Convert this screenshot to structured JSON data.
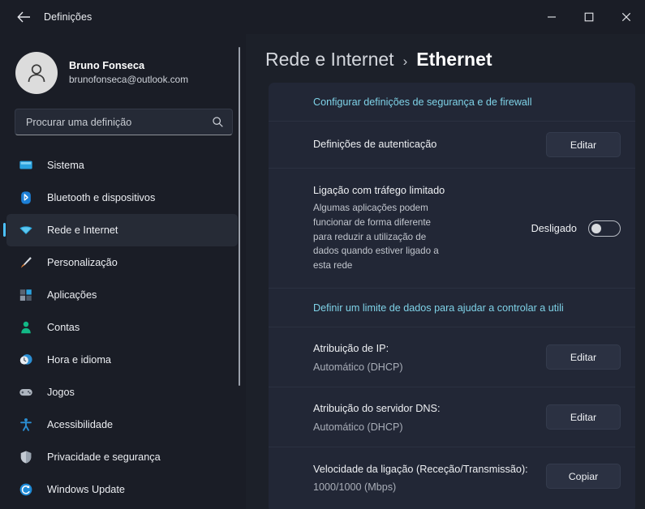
{
  "window": {
    "title": "Definições",
    "back_icon": "back-arrow-icon",
    "controls": {
      "minimize": "minimize-icon",
      "maximize": "maximize-icon",
      "close": "close-icon"
    }
  },
  "accent_color": "#4cc2ff",
  "link_color": "#7fd3e8",
  "sidebar": {
    "account": {
      "name": "Bruno Fonseca",
      "email": "brunofonseca@outlook.com",
      "avatar_icon": "person-avatar-icon"
    },
    "search": {
      "placeholder": "Procurar uma definição",
      "value": "",
      "icon": "search-icon"
    },
    "items": [
      {
        "label": "Sistema",
        "icon": "monitor-icon",
        "active": false
      },
      {
        "label": "Bluetooth e dispositivos",
        "icon": "bluetooth-icon",
        "active": false
      },
      {
        "label": "Rede e Internet",
        "icon": "wifi-icon",
        "active": true
      },
      {
        "label": "Personalização",
        "icon": "paintbrush-icon",
        "active": false
      },
      {
        "label": "Aplicações",
        "icon": "apps-grid-icon",
        "active": false
      },
      {
        "label": "Contas",
        "icon": "person-icon",
        "active": false
      },
      {
        "label": "Hora e idioma",
        "icon": "clock-globe-icon",
        "active": false
      },
      {
        "label": "Jogos",
        "icon": "gamepad-icon",
        "active": false
      },
      {
        "label": "Acessibilidade",
        "icon": "accessibility-icon",
        "active": false
      },
      {
        "label": "Privacidade e segurança",
        "icon": "shield-icon",
        "active": false
      },
      {
        "label": "Windows Update",
        "icon": "refresh-icon",
        "active": false
      }
    ]
  },
  "main": {
    "breadcrumb": {
      "parent": "Rede e Internet",
      "separator": "›",
      "current": "Ethernet"
    },
    "firewall_link": "Configurar definições de segurança e de firewall",
    "rows": {
      "auth": {
        "title": "Definições de autenticação",
        "button": "Editar"
      },
      "metered": {
        "title": "Ligação com tráfego limitado",
        "description": "Algumas aplicações podem funcionar de forma diferente para reduzir a utilização de dados quando estiver ligado a esta rede",
        "toggle_state": "Desligado"
      },
      "data_limit_link": "Definir um limite de dados para ajudar a controlar a utili",
      "ip": {
        "title": "Atribuição de IP:",
        "value": "Automático (DHCP)",
        "button": "Editar"
      },
      "dns": {
        "title": "Atribuição do servidor DNS:",
        "value": "Automático (DHCP)",
        "button": "Editar"
      },
      "speed": {
        "title": "Velocidade da ligação (Receção/Transmissão):",
        "value": "1000/1000 (Mbps)",
        "button": "Copiar"
      }
    }
  }
}
